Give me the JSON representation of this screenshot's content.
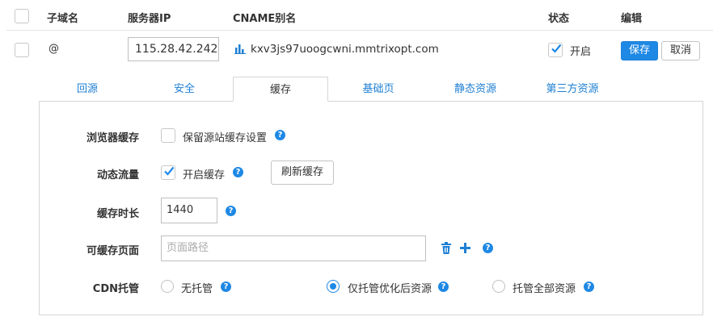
{
  "table": {
    "headers": {
      "subdomain": "子域名",
      "server_ip": "服务器IP",
      "cname": "CNAME别名",
      "status": "状态",
      "edit": "编辑"
    },
    "row": {
      "subdomain": "@",
      "server_ip": "115.28.42.242",
      "cname": "kxv3js97uoogcwni.mmtrixopt.com",
      "status_label": "开启",
      "status_checked": true,
      "save_label": "保存",
      "cancel_label": "取消"
    }
  },
  "tabs": [
    {
      "label": "回源",
      "active": false
    },
    {
      "label": "安全",
      "active": false
    },
    {
      "label": "缓存",
      "active": true
    },
    {
      "label": "基础页",
      "active": false
    },
    {
      "label": "静态资源",
      "active": false
    },
    {
      "label": "第三方资源",
      "active": false
    }
  ],
  "cache": {
    "browser_cache": {
      "label": "浏览器缓存",
      "option_label": "保留源站缓存设置",
      "checked": false
    },
    "dynamic_traffic": {
      "label": "动态流量",
      "option_label": "开启缓存",
      "checked": true,
      "refresh_label": "刷新缓存"
    },
    "cache_duration": {
      "label": "缓存时长",
      "value": "1440"
    },
    "cacheable_pages": {
      "label": "可缓存页面",
      "placeholder": "页面路径"
    },
    "cdn_hosting": {
      "label": "CDN托管",
      "options": [
        {
          "label": "无托管",
          "selected": false
        },
        {
          "label": "仅托管优化后资源",
          "selected": true
        },
        {
          "label": "托管全部资源",
          "selected": false
        }
      ]
    }
  },
  "colors": {
    "accent": "#1e88e5",
    "link": "#1e7fd3",
    "border": "#d6d6d6"
  }
}
